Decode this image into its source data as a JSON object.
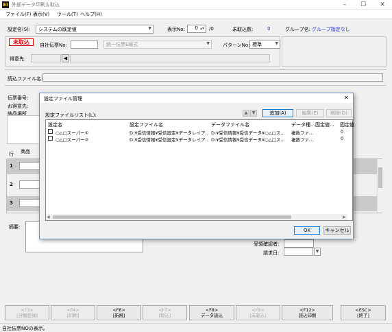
{
  "window": {
    "title": "外部データ印刷＆取込",
    "icon_text": "EI"
  },
  "menu": [
    "ファイル(F)",
    "表示(V)",
    "ツール(T)",
    "ヘルプ(H)"
  ],
  "top": {
    "setting_label": "設定名(S):",
    "setting_value": "システムの既定値",
    "display_no_label": "表示No:",
    "display_no_value": "0",
    "display_no_total": "/0",
    "untaken_label": "未取込数:",
    "untaken_value": "0",
    "group_label": "グループ名:",
    "group_value": "グループ指定なし"
  },
  "header": {
    "status_badge": "未取込",
    "slip_no_label": "自社伝票No:",
    "slip_type_value": "統一伝票E様式",
    "pattern_label": "パターンNo:",
    "pattern_value": "標準",
    "customer_label": "得意先:"
  },
  "file_section": {
    "label": "読込ファイル名:"
  },
  "background": {
    "slip_no_label": "伝票番号:",
    "customer_label": "お得意先:",
    "delivery_label": "納品場所",
    "row_label": "行",
    "product_label": "商品",
    "rows": [
      "1",
      "2",
      "3"
    ],
    "remarks_label": "摘要:",
    "receipt_label": "受領確認者:",
    "billing_label": "請求日:"
  },
  "dialog": {
    "title": "設定ファイル管理",
    "list_label": "設定ファイルリスト(L):",
    "add_btn": "追加(A)",
    "edit_btn": "編集(E)",
    "delete_btn": "削除(D)",
    "columns": [
      "設定名",
      "設定ファイル名",
      "データファイル名",
      "データ種...",
      "固定値...",
      "固定値"
    ],
    "rows": [
      {
        "name": "○△□スーパー①",
        "setting_file": "D:¥受信情報¥受信設定¥データレイア...",
        "data_file": "D:¥受信情報¥受信データ¥○△□ス...",
        "data_type": "複数ファ...",
        "fixed": "0"
      },
      {
        "name": "○△□スーパー②",
        "setting_file": "D:¥受信情報¥受信設定¥データレイア...",
        "data_file": "D:¥受信情報¥受信データ¥○△□ス...",
        "data_type": "複数ファ...",
        "fixed": "0"
      }
    ],
    "ok_btn": "OK",
    "cancel_btn": "キャンセル",
    "close_glyph": "✕"
  },
  "fkeys": [
    {
      "key": "<F3>",
      "label": "[分類登録]",
      "enabled": false
    },
    {
      "key": "<F4>",
      "label": "[印刷]",
      "enabled": false
    },
    {
      "key": "<F6>",
      "label": "[新規]",
      "enabled": true
    },
    {
      "key": "<F7>",
      "label": "[取込]",
      "enabled": false
    },
    {
      "key": "<F8>",
      "label": "データ読込",
      "enabled": true
    },
    {
      "key": "<F9>",
      "label": "[未取込]",
      "enabled": false
    },
    {
      "key": "<F12>",
      "label": "読込印刷",
      "enabled": true
    },
    {
      "key": "<ESC>",
      "label": "[終了]",
      "enabled": true
    }
  ],
  "status": "自社伝票NOの表示。"
}
